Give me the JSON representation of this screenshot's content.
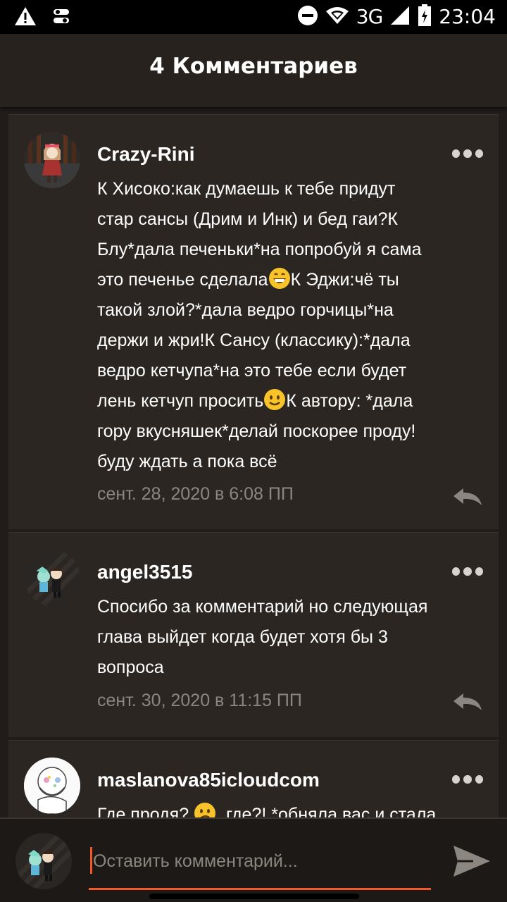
{
  "status_bar": {
    "network": "3G",
    "time": "23:04",
    "icons": [
      "warning-icon",
      "toggle-icon",
      "dnd-icon",
      "wifi-icon",
      "signal-icon",
      "battery-icon"
    ]
  },
  "header": {
    "title": "4 Комментариев"
  },
  "comments": [
    {
      "author": "Crazy-Rini",
      "text": [
        "К Хисоко:как думаешь к тебе придут",
        "стар сансы (Дрим и Инк) и бед гаи?К",
        "Блу*дала печеньки*на попробуй я сама",
        "это печенье сделала",
        "К Эджи:чё ты",
        "такой злой?*дала ведро горчицы*на",
        "держи и жри!К Сансу (классику):*дала",
        "ведро кетчупа*на это тебе если будет",
        "лень кетчуп просить",
        "К автору: *дала",
        "гору вкусняшек*делай поскорее проду!",
        "буду ждать а пока всё"
      ],
      "date": "сент. 28, 2020 в 6:08 ПП"
    },
    {
      "author": "angel3515",
      "text": [
        "Спосибо за комментарий но следующая",
        "глава выйдет когда будет хотя бы 3",
        "вопроса"
      ],
      "date": "сент. 30, 2020 в 11:15 ПП"
    },
    {
      "author": "maslanova85icloudcom",
      "text": [
        "Где продя? ",
        ", где?! *обняла вас и стала"
      ]
    }
  ],
  "composer": {
    "placeholder": "Оставить комментарий..."
  },
  "colors": {
    "accent": "#f1582a",
    "background": "#211c19",
    "card": "#2b2622",
    "date_text": "#8c8681"
  }
}
